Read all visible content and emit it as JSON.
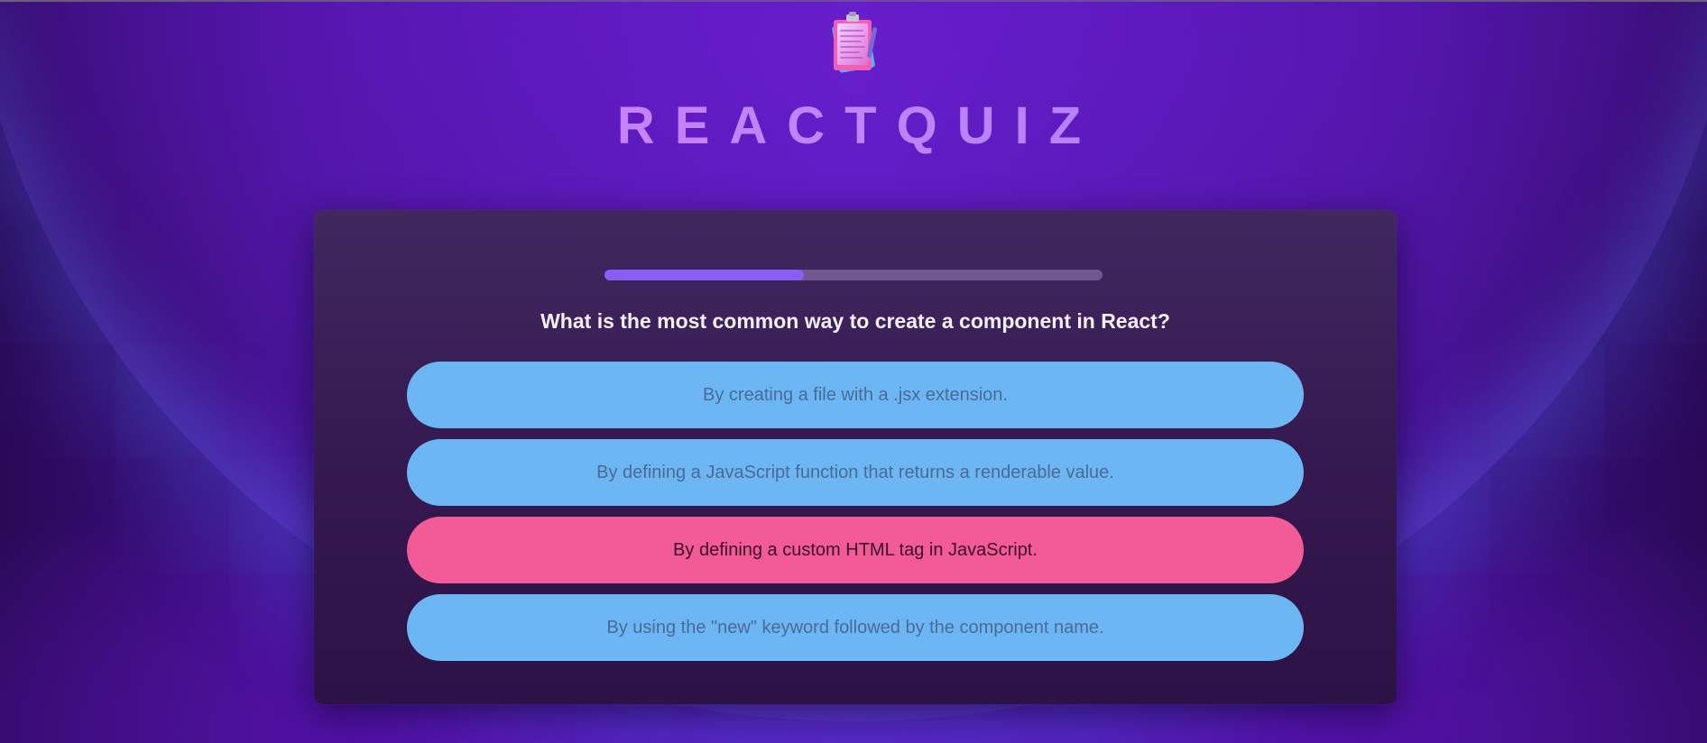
{
  "app": {
    "title": "REACTQUIZ",
    "logo_icon": "clipboard-quiz-icon"
  },
  "quiz": {
    "progress": 0.4,
    "question": "What is the most common way to create a component in React?",
    "options": [
      {
        "label": "By creating a file with a .jsx extension.",
        "selected": false
      },
      {
        "label": "By defining a JavaScript function that returns a renderable value.",
        "selected": false
      },
      {
        "label": "By defining a custom HTML tag in JavaScript.",
        "selected": true
      },
      {
        "label": "By using the \"new\" keyword followed by the component name.",
        "selected": false
      }
    ]
  },
  "colors": {
    "option_default": "#6cb6f4",
    "option_selected": "#f35b96",
    "progress_fill": "#8b5cf6",
    "title_gradient_start": "#d67cf2",
    "title_gradient_end": "#9a7af5"
  }
}
